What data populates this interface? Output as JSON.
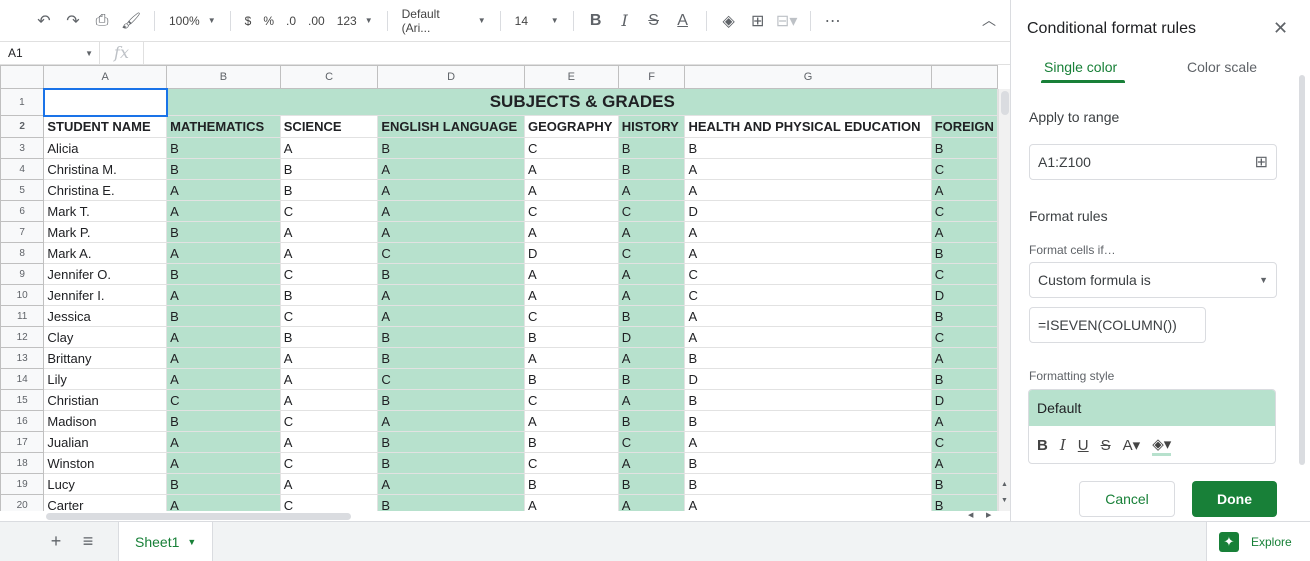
{
  "toolbar": {
    "zoom": "100%",
    "currency": "$",
    "percent": "%",
    "dec_less": ".0",
    "dec_more": ".00",
    "more_formats": "123",
    "font": "Default (Ari...",
    "font_size": "14"
  },
  "formula_bar": {
    "cell_ref": "A1",
    "fx": "fx",
    "content": ""
  },
  "columns": [
    "A",
    "B",
    "C",
    "D",
    "E",
    "F",
    "G",
    ""
  ],
  "title": "SUBJECTS & GRADES",
  "headers": [
    "STUDENT NAME",
    "MATHEMATICS",
    "SCIENCE",
    "ENGLISH LANGUAGE",
    "GEOGRAPHY",
    "HISTORY",
    "HEALTH AND PHYSICAL EDUCATION",
    "FOREIGN"
  ],
  "rows": [
    [
      "Alicia",
      "B",
      "A",
      "B",
      "C",
      "B",
      "B",
      "B"
    ],
    [
      "Christina M.",
      "B",
      "B",
      "A",
      "A",
      "B",
      "A",
      "C"
    ],
    [
      "Christina E.",
      "A",
      "B",
      "A",
      "A",
      "A",
      "A",
      "A"
    ],
    [
      "Mark T.",
      "A",
      "C",
      "A",
      "C",
      "C",
      "D",
      "C"
    ],
    [
      "Mark P.",
      "B",
      "A",
      "A",
      "A",
      "A",
      "A",
      "A"
    ],
    [
      "Mark A.",
      "A",
      "A",
      "C",
      "D",
      "C",
      "A",
      "B"
    ],
    [
      "Jennifer O.",
      "B",
      "C",
      "B",
      "A",
      "A",
      "C",
      "C"
    ],
    [
      "Jennifer I.",
      "A",
      "B",
      "A",
      "A",
      "A",
      "C",
      "D"
    ],
    [
      "Jessica",
      "B",
      "C",
      "A",
      "C",
      "B",
      "A",
      "B"
    ],
    [
      "Clay",
      "A",
      "B",
      "B",
      "B",
      "D",
      "A",
      "C"
    ],
    [
      "Brittany",
      "A",
      "A",
      "B",
      "A",
      "A",
      "B",
      "A"
    ],
    [
      "Lily",
      "A",
      "A",
      "C",
      "B",
      "B",
      "D",
      "B"
    ],
    [
      "Christian",
      "C",
      "A",
      "B",
      "C",
      "A",
      "B",
      "D"
    ],
    [
      "Madison",
      "B",
      "C",
      "A",
      "A",
      "B",
      "B",
      "A"
    ],
    [
      "Jualian",
      "A",
      "A",
      "B",
      "B",
      "C",
      "A",
      "C"
    ],
    [
      "Winston",
      "A",
      "C",
      "B",
      "C",
      "A",
      "B",
      "A"
    ],
    [
      "Lucy",
      "B",
      "A",
      "A",
      "B",
      "B",
      "B",
      "B"
    ],
    [
      "Carter",
      "A",
      "C",
      "B",
      "A",
      "A",
      "A",
      "B"
    ]
  ],
  "bottom": {
    "sheet_tab": "Sheet1",
    "explore": "Explore"
  },
  "panel": {
    "title": "Conditional format rules",
    "tab_single": "Single color",
    "tab_scale": "Color scale",
    "apply_label": "Apply to range",
    "range": "A1:Z100",
    "format_rules_label": "Format rules",
    "format_cells_if": "Format cells if…",
    "condition": "Custom formula is",
    "formula": "=ISEVEN(COLUMN())",
    "formatting_style": "Formatting style",
    "style_preview": "Default",
    "cancel": "Cancel",
    "done": "Done"
  },
  "colors": {
    "highlight": "#b7e1cd",
    "accent": "#188038",
    "selection": "#1a73e8"
  }
}
